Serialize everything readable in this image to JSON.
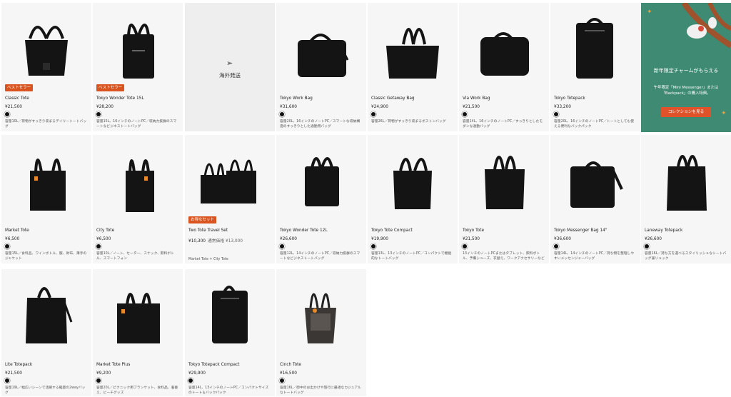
{
  "products": [
    {
      "name": "Classic Tote",
      "price": "¥21,500",
      "badge": "ベストセラー",
      "desc": "容量10L／荷物がすっきり収まるデイリートートバッグ"
    },
    {
      "name": "Tokyo Wonder Tote 15L",
      "price": "¥28,200",
      "badge": "ベストセラー",
      "desc": "容量15L、16インチのノートPC／収納力抜群のスマートなビジネストートバッグ"
    },
    {
      "name": "Tokyo Work Bag",
      "price": "¥31,600",
      "badge": "",
      "desc": "容量20L、16インチのノートPC／スマートな収納構造のすっきりとした通勤用バッグ"
    },
    {
      "name": "Classic Getaway Bag",
      "price": "¥24,900",
      "badge": "",
      "desc": "容量26L／荷物がすっきり収まるボストンバッグ"
    },
    {
      "name": "Via Work Bag",
      "price": "¥21,500",
      "badge": "",
      "desc": "容量14L、16インチのノートPC／すっきりとしたモダンな通勤バッグ"
    },
    {
      "name": "Tokyo Totepack",
      "price": "¥33,200",
      "badge": "",
      "desc": "容量20L、16インチのノートPC／トートとしても使える便利なバックパック"
    },
    {
      "name": "Market Tote",
      "price": "¥6,500",
      "badge": "",
      "desc": "容量15L／食料品、ワインボトル、服、財布、薄手のジャケット"
    },
    {
      "name": "City Tote",
      "price": "¥6,500",
      "badge": "",
      "desc": "容量10L／ノート、セーター、スナック、飲料ボトル、スマートフォン"
    },
    {
      "name": "Two Tote Travel Set",
      "price": "¥10,300",
      "orig": "通常価格 ¥13,000",
      "badge": "お得なセット",
      "desc": "Market Tote + City Tote"
    },
    {
      "name": "Tokyo Wonder Tote 12L",
      "price": "¥26,600",
      "badge": "",
      "desc": "容量12L、14インチのノートPC／収納力抜群のスマートなビジネストートバッグ"
    },
    {
      "name": "Tokyo Tote Compact",
      "price": "¥19,900",
      "badge": "",
      "desc": "容量13L、13インチのノートPC／コンパクトで機能的なトートバッグ"
    },
    {
      "name": "Tokyo Tote",
      "price": "¥21,500",
      "badge": "",
      "desc": "13インチのノートPCまたはタブレット、飲料ボトル、予備シューズ、衣替え、ワークアクセサリーなど"
    },
    {
      "name": "Tokyo Messenger Bag 14\"",
      "price": "¥36,600",
      "badge": "",
      "desc": "容量14L、14インチのノートPC／持ち物を整理しやすいメッセンジャーバッグ"
    },
    {
      "name": "Laneway Totepack",
      "price": "¥26,600",
      "badge": "",
      "desc": "容量16L／持ち方を選べるスタイリッシュなトートバッグ兼リュック"
    },
    {
      "name": "Lite Totepack",
      "price": "¥21,500",
      "badge": "",
      "desc": "容量19L／幅広いシーンで活躍する軽量の2wayバッグ"
    },
    {
      "name": "Market Tote Plus",
      "price": "¥9,200",
      "badge": "",
      "desc": "容量20L／ピクニック用ブランケット、食料品、着替え、ビーチグッズ"
    },
    {
      "name": "Tokyo Totepack Compact",
      "price": "¥29,900",
      "badge": "",
      "desc": "容量14L、13インチのノートPC／コンパクトサイズのトート＆バックパック"
    },
    {
      "name": "Cinch Tote",
      "price": "¥16,500",
      "badge": "",
      "desc": "容量16L／街中のお出かけや旅行に最適なカジュアルなトートバッグ"
    }
  ],
  "intl": {
    "label": "海外発送",
    "icon": "paper-plane-icon"
  },
  "promo": {
    "title": "新年限定チャームがもらえる",
    "subtitle": "午年限定「Mini Messenger」または「Backpack」の購入特典。",
    "button": "コレクションを見る",
    "bg": "#3f8a73",
    "button_color": "#e0532a"
  },
  "colors": {
    "badge": "#d9541e",
    "card_bg": "#f6f6f6",
    "bag": "#141414"
  }
}
